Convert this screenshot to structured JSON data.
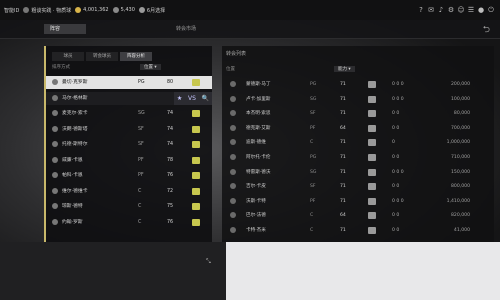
{
  "topbar": {
    "club": "智能ID",
    "level": "粗谈实践 · 物质球",
    "coins": "4,001,362",
    "points": "5,430",
    "squad": "6月选择",
    "colors": {
      "coins": "#d8b44a",
      "points": "#8a8a8a"
    }
  },
  "nav": {
    "tabs": [
      "阵容",
      "转会市场"
    ]
  },
  "left": {
    "subtabs": [
      "球员",
      "转会球员",
      "阵容分析"
    ],
    "filter_label": "排序方式",
    "sort": "位置",
    "rows": [
      {
        "name": "曼切·克罗斯",
        "pos": "PG",
        "ovr": "80"
      },
      {
        "name": "马尔·格林斯",
        "pos": "",
        "ovr": ""
      },
      {
        "name": "麦克尔·索卡",
        "pos": "SG",
        "ovr": "74"
      },
      {
        "name": "沃朗·德斯塔",
        "pos": "SF",
        "ovr": "74"
      },
      {
        "name": "托德·斯特尔",
        "pos": "SF",
        "ovr": "74"
      },
      {
        "name": "威廉·卡恩",
        "pos": "PF",
        "ovr": "78"
      },
      {
        "name": "帕科·卡恩",
        "pos": "PF",
        "ovr": "76"
      },
      {
        "name": "维尔·德维卡",
        "pos": "C",
        "ovr": "72"
      },
      {
        "name": "琼斯·德特",
        "pos": "C",
        "ovr": "75"
      },
      {
        "name": "约翰·罗斯",
        "pos": "C",
        "ovr": "76"
      }
    ],
    "hover_actions": [
      "★",
      "VS",
      "🔍"
    ]
  },
  "right": {
    "title": "转会列表",
    "col_filter": "位置",
    "sort": "能力",
    "rows": [
      {
        "name": "蒙德斯·马丁",
        "pos": "PG",
        "ovr": "71",
        "chem": "0 0 0",
        "price": "200,000"
      },
      {
        "name": "卢卡·加里斯",
        "pos": "SG",
        "ovr": "71",
        "chem": "0 0 0",
        "price": "100,000"
      },
      {
        "name": "本杰明·索思",
        "pos": "SF",
        "ovr": "71",
        "chem": "0 0",
        "price": "80,000"
      },
      {
        "name": "德克斯·艾斯",
        "pos": "PF",
        "ovr": "64",
        "chem": "0 0",
        "price": "700,000"
      },
      {
        "name": "迪斯·德维",
        "pos": "C",
        "ovr": "71",
        "chem": "0",
        "price": "1,000,000"
      },
      {
        "name": "阿尔托·卡伦",
        "pos": "PG",
        "ovr": "71",
        "chem": "0 0",
        "price": "710,000"
      },
      {
        "name": "特雷斯·德沃",
        "pos": "SG",
        "ovr": "71",
        "chem": "0 0 0",
        "price": "150,000"
      },
      {
        "name": "吉尔·卡皮",
        "pos": "SF",
        "ovr": "71",
        "chem": "0 0",
        "price": "800,000"
      },
      {
        "name": "沃斯·卡特",
        "pos": "PF",
        "ovr": "71",
        "chem": "0 0 0",
        "price": "1,410,000"
      },
      {
        "name": "巴尔·法德",
        "pos": "C",
        "ovr": "64",
        "chem": "0 0",
        "price": "820,000"
      },
      {
        "name": "卡特·杰米",
        "pos": "C",
        "ovr": "71",
        "chem": "0 0",
        "price": "41,000"
      }
    ],
    "confirm": ""
  }
}
